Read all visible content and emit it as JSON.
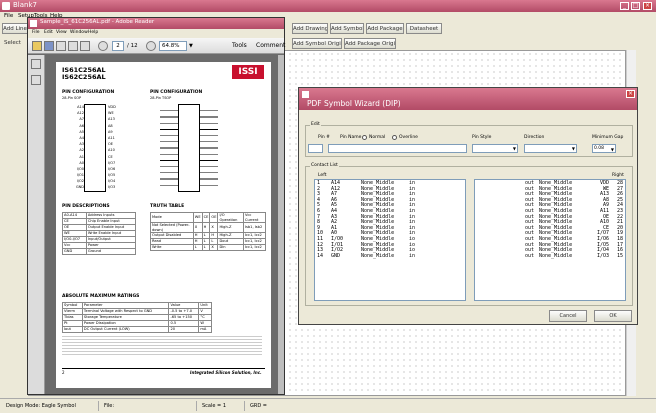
{
  "main_window": {
    "title": "Blank7",
    "menu": [
      "File",
      "Setup",
      "Tools",
      "Help"
    ],
    "toolbar_left": [
      "Add Line",
      "Select"
    ],
    "top_buttons": [
      "Add Drawing",
      "Add Symbol",
      "Add Package",
      "Datasheet"
    ],
    "second_buttons": [
      "Add Symbol Origin",
      "Add Package Origin"
    ]
  },
  "pdf_viewer": {
    "title": "Sample_IS_61C256AL.pdf - Adobe Reader",
    "menu": [
      "File",
      "Edit",
      "View",
      "Window",
      "Help"
    ],
    "page_current": "2",
    "page_total": "/ 12",
    "zoom": "64.8%",
    "tools_label": "Tools",
    "comment_label": "Comment",
    "doc": {
      "part1": "IS61C256AL",
      "part2": "IS62C256AL",
      "logo": "ISSI",
      "pin_config_1": "PIN CONFIGURATION",
      "pin_config_1_sub": "28-Pin SOP",
      "pin_config_2": "PIN CONFIGURATION",
      "pin_config_2_sub": "28-Pin TSOP",
      "sop_left": [
        "A14",
        "A12",
        "A7",
        "A6",
        "A5",
        "A4",
        "A3",
        "A2",
        "A1",
        "A0",
        "I/O0",
        "I/O1",
        "I/O2",
        "GND"
      ],
      "sop_right": [
        "VDD",
        "WE",
        "A13",
        "A8",
        "A9",
        "A11",
        "OE",
        "A10",
        "CE",
        "I/O7",
        "I/O6",
        "I/O5",
        "I/O4",
        "I/O3"
      ],
      "pin_desc_title": "PIN DESCRIPTIONS",
      "pin_desc": [
        [
          "A0-A14",
          "Address Inputs"
        ],
        [
          "CE",
          "Chip Enable Input"
        ],
        [
          "OE",
          "Output Enable Input"
        ],
        [
          "WE",
          "Write Enable Input"
        ],
        [
          "I/O0-I/O7",
          "Input/Output"
        ],
        [
          "Vcc",
          "Power"
        ],
        [
          "GND",
          "Ground"
        ]
      ],
      "truth_title": "TRUTH TABLE",
      "truth_head": [
        "Mode",
        "WE",
        "CE",
        "OE",
        "I/O Operation",
        "Vcc Current"
      ],
      "truth_rows": [
        [
          "Not Selected (Power-down)",
          "X",
          "H",
          "X",
          "High-Z",
          "Isb1, Isb2"
        ],
        [
          "Output Disabled",
          "H",
          "L",
          "H",
          "High-Z",
          "Icc1, Icc2"
        ],
        [
          "Read",
          "H",
          "L",
          "L",
          "Dout",
          "Icc1, Icc2"
        ],
        [
          "Write",
          "L",
          "L",
          "X",
          "Din",
          "Icc1, Icc2"
        ]
      ],
      "abs_title": "ABSOLUTE MAXIMUM RATINGS",
      "abs_head": [
        "Symbol",
        "Parameter",
        "Value",
        "Unit"
      ],
      "abs_rows": [
        [
          "Vterm",
          "Terminal Voltage with Respect to GND",
          "-0.5 to +7.0",
          "V"
        ],
        [
          "Tbias",
          "Storage Temperature",
          "-65 to +150",
          "°C"
        ],
        [
          "Pt",
          "Power Dissipation",
          "0.5",
          "W"
        ],
        [
          "Iout",
          "DC Output Current (LOW)",
          "20",
          "mA"
        ]
      ],
      "footer_company": "Integrated Silicon Solution, Inc.",
      "page_num": "2"
    }
  },
  "wizard": {
    "title": "PDF Symbol Wizard (DIP)",
    "edit_label": "Edit",
    "pin_num_label": "Pin #",
    "pin_name_label": "Pin Name",
    "normal_label": "Normal",
    "overline_label": "Overline",
    "pin_style_label": "Pin Style",
    "direction_label": "Direction",
    "min_gap_label": "Minimum Gap",
    "min_gap_value": "0.08",
    "contact_list_label": "Contact List",
    "left_header": "Left",
    "right_header": "Right",
    "left_rows": [
      [
        "1",
        "A14",
        "None_Middle",
        "in"
      ],
      [
        "2",
        "A12",
        "None_Middle",
        "in"
      ],
      [
        "3",
        "A7",
        "None_Middle",
        "in"
      ],
      [
        "4",
        "A6",
        "None_Middle",
        "in"
      ],
      [
        "5",
        "A5",
        "None_Middle",
        "in"
      ],
      [
        "6",
        "A4",
        "None_Middle",
        "in"
      ],
      [
        "7",
        "A3",
        "None_Middle",
        "in"
      ],
      [
        "8",
        "A2",
        "None_Middle",
        "in"
      ],
      [
        "9",
        "A1",
        "None_Middle",
        "in"
      ],
      [
        "10",
        "A0",
        "None_Middle",
        "in"
      ],
      [
        "11",
        "I/O0",
        "None_Middle",
        "io"
      ],
      [
        "12",
        "I/O1",
        "None_Middle",
        "io"
      ],
      [
        "13",
        "I/O2",
        "None_Middle",
        "io"
      ],
      [
        "14",
        "GND",
        "None_Middle",
        "in"
      ]
    ],
    "right_rows": [
      [
        "out",
        "None_Middle",
        "VDD",
        "28"
      ],
      [
        "out",
        "None_Middle",
        "WE",
        "27"
      ],
      [
        "out",
        "None_Middle",
        "A13",
        "26"
      ],
      [
        "out",
        "None_Middle",
        "A8",
        "25"
      ],
      [
        "out",
        "None_Middle",
        "A9",
        "24"
      ],
      [
        "out",
        "None_Middle",
        "A11",
        "23"
      ],
      [
        "out",
        "None_Middle",
        "OE",
        "22"
      ],
      [
        "out",
        "None_Middle",
        "A10",
        "21"
      ],
      [
        "out",
        "None_Middle",
        "CE",
        "20"
      ],
      [
        "out",
        "None_Middle",
        "I/O7",
        "19"
      ],
      [
        "out",
        "None_Middle",
        "I/O6",
        "18"
      ],
      [
        "out",
        "None_Middle",
        "I/O5",
        "17"
      ],
      [
        "out",
        "None_Middle",
        "I/O4",
        "16"
      ],
      [
        "out",
        "None_Middle",
        "I/O3",
        "15"
      ]
    ],
    "cancel_label": "Cancel",
    "ok_label": "OK"
  },
  "status_bar": {
    "mode": "Design Mode: Eagle Symbol",
    "file": "File:",
    "scale": "Scale = 1",
    "grid": "GRD ="
  }
}
